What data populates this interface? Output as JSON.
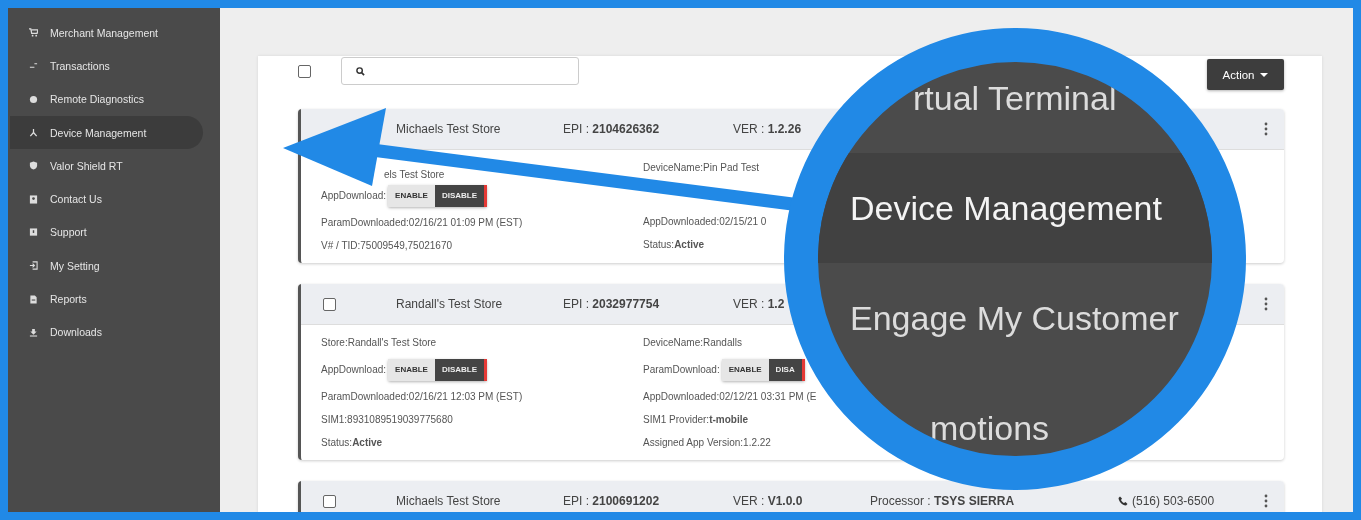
{
  "sidebar": {
    "items": [
      {
        "label": "Merchant Management",
        "selected": false
      },
      {
        "label": "Transactions",
        "selected": false
      },
      {
        "label": "Remote Diagnostics",
        "selected": false
      },
      {
        "label": "Device Management",
        "selected": true
      },
      {
        "label": "Valor Shield RT",
        "selected": false
      },
      {
        "label": "Contact Us",
        "selected": false
      },
      {
        "label": "Support",
        "selected": false
      },
      {
        "label": "My Setting",
        "selected": false
      },
      {
        "label": "Reports",
        "selected": false
      },
      {
        "label": "Downloads",
        "selected": false
      }
    ]
  },
  "toolbar": {
    "select_all_checked": false,
    "action_button": "Action"
  },
  "cards": [
    {
      "store": "Michaels Test Store",
      "epi": "EPI : **2104626362**",
      "ver": "VER : **1.2.26**",
      "left": [
        {
          "kind": "covered",
          "text": "els Test Store"
        },
        {
          "kind": "toggle",
          "label": "AppDownload:",
          "options": [
            {
              "label": "ENABLE",
              "selected": false
            },
            {
              "label": "DISABLE",
              "selected": true
            }
          ]
        },
        {
          "kind": "text",
          "text": "ParamDownloaded:02/16/21 01:09 PM (EST)"
        },
        {
          "kind": "text",
          "text": "V# / TID:75009549,75021670"
        }
      ],
      "right": [
        {
          "kind": "text",
          "text": "DeviceName:Pin Pad Test"
        },
        {
          "kind": "toggle"
        },
        {
          "kind": "text",
          "text": "AppDownloaded:02/15/21 0"
        },
        {
          "kind": "text",
          "text": "Status:**Active**"
        }
      ]
    },
    {
      "checked": false,
      "store": "Randall's Test Store",
      "epi": "EPI : **2032977754**",
      "ver": "VER : **1.2**",
      "left": [
        {
          "kind": "text",
          "text": "Store:Randall's Test Store"
        },
        {
          "kind": "toggle",
          "label": "AppDownload:",
          "options": [
            {
              "label": "ENABLE",
              "selected": false
            },
            {
              "label": "DISABLE",
              "selected": true
            }
          ]
        },
        {
          "kind": "text",
          "text": "ParamDownloaded:02/16/21 12:03 PM (EST)"
        },
        {
          "kind": "text",
          "text": "SIM1:8931089519039775680"
        },
        {
          "kind": "text",
          "text": "Status:**Active**"
        }
      ],
      "right": [
        {
          "kind": "text",
          "text": "DeviceName:Randalls"
        },
        {
          "kind": "toggle",
          "label": "ParamDownload:",
          "options": [
            {
              "label": "ENABLE",
              "selected": false
            },
            {
              "label": "DISA",
              "selected": true
            }
          ]
        },
        {
          "kind": "text",
          "text": "AppDownloaded:02/12/21 03:31 PM (E"
        },
        {
          "kind": "text",
          "text": "SIM1 Provider:**t-mobile**"
        },
        {
          "kind": "text",
          "text": "Assigned App Version:1.2.22"
        }
      ]
    },
    {
      "checked": false,
      "store": "Michaels Test Store",
      "epi": "EPI : **2100691202**",
      "ver": "VER : **V1.0.0**",
      "processor": "Processor : **TSYS SIERRA**",
      "phone": "(516) 503-6500"
    }
  ],
  "magnifier": {
    "items": [
      {
        "label": "rtual Terminal",
        "selected": false
      },
      {
        "label": "Device Management",
        "selected": true
      },
      {
        "label": "Engage My Customer",
        "selected": false
      },
      {
        "label": "motions",
        "selected": false
      }
    ]
  }
}
